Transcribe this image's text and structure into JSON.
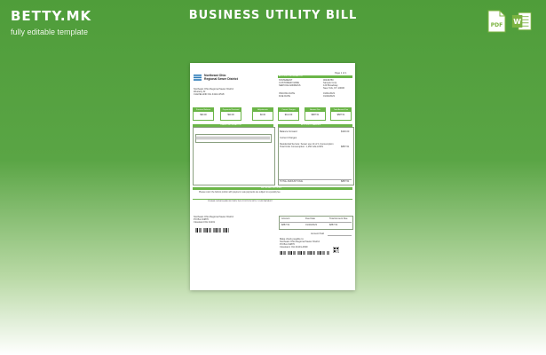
{
  "brand": {
    "logo": "BETTY.MK",
    "tagline": "fully editable template"
  },
  "header": {
    "title": "BUSINESS UTILITY BILL"
  },
  "formats": [
    {
      "label": "PDF",
      "icon": "pdf-file-icon",
      "color": "#7cb342"
    },
    {
      "label": "W",
      "icon": "word-file-icon",
      "color": "#7cb342"
    }
  ],
  "colors": {
    "accent": "#6bb548",
    "background": "#5aa545"
  },
  "document": {
    "page_label": "Page 1 of 1",
    "company_name_1": "Northeast Ohio",
    "company_name_2": "Regional Sewer District",
    "account_info_header": "ACCOUNT INFORMATION",
    "info_rows": [
      {
        "label": "STATEMENT",
        "value": "00346780"
      },
      {
        "label": "CUSTOMER NAME",
        "value": "Sample Corp"
      },
      {
        "label": "SERVICE ADDRESS",
        "value": "123 Broadway"
      },
      {
        "label": "",
        "value": "New York, NY 10006"
      },
      {
        "label": "ISSUING DATE",
        "value": "01/01/2023"
      },
      {
        "label": "DUE DATE",
        "value": "01/20/2023"
      }
    ],
    "address_lines": [
      "Northeast Ohio Regional Sewer District",
      "Westerly Dr",
      "CLEVELAND OH 44114-3518"
    ],
    "tiles": [
      {
        "label": "Previous Balance",
        "value": "$90.00"
      },
      {
        "label": "Payments Received",
        "value": "$90.00"
      },
      {
        "label": "Adjustments",
        "value": "$0.00"
      },
      {
        "label": "Current Charges",
        "value": "$112.00"
      },
      {
        "label": "Amount Due",
        "value": "$887.51"
      },
      {
        "label": "Total Amount Due",
        "value": "$887.51"
      }
    ],
    "usage_header": "USAGE INFORMATION",
    "charges_header": "ACCOUNT CHARGES",
    "charges_rows": [
      {
        "label": "Balance Forward",
        "value": "$330.00"
      },
      {
        "label": "Current Charges",
        "value": ""
      },
      {
        "label": "Residential Service: Sewer use 14 of 1 Consumption",
        "value": ""
      },
      {
        "label": "Total Units Consumption: 1,150 GALLONS",
        "value": "$887.51"
      }
    ],
    "total_row": {
      "label": "TOTAL AMOUNT DUE",
      "value": "$887.51"
    },
    "notice_header": "IMPORTANT NOTICES",
    "notice_text": "Please return the bottom portion with payment. Late payments are subject to a penalty fee.",
    "notice_link": "PLEASE DETACH AND RETURN THIS PORTION WITH YOUR PAYMENT",
    "stub_address": [
      "Northeast Ohio Regional Sewer District",
      "PO Box 94876",
      "Cleveland OH 44101"
    ],
    "stub_table": {
      "headers": [
        "Account",
        "Due Date",
        "Total Amount Due"
      ],
      "values": [
        "$887.51",
        "01/20/2023",
        "$887.51"
      ]
    },
    "amount_paid_label": "Amount Paid",
    "remit_label": "Make check payable to:",
    "remit_lines": [
      "Northeast Ohio Regional Sewer District",
      "PO Box 94876",
      "Cleveland, OH 44101-4939"
    ]
  }
}
